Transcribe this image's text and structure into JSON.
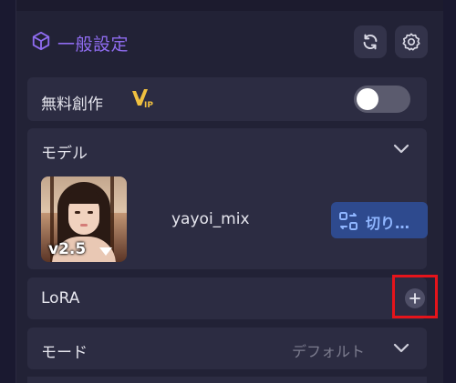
{
  "header": {
    "title": "一般設定",
    "refresh_icon": "refresh-icon",
    "settings_icon": "gear-icon"
  },
  "free_creation": {
    "label": "無料創作",
    "badge_text": "VIP",
    "toggle_on": false
  },
  "model": {
    "label": "モデル",
    "version": "v2.5",
    "name": "yayoi_mix",
    "switch_label": "切り…"
  },
  "lora": {
    "label": "LoRA"
  },
  "mode": {
    "label": "モード",
    "value": "デフォルト"
  },
  "colors": {
    "accent_purple": "#8f6cf0",
    "switch_blue": "#2e4a8e",
    "highlight_red": "#e5141b"
  }
}
